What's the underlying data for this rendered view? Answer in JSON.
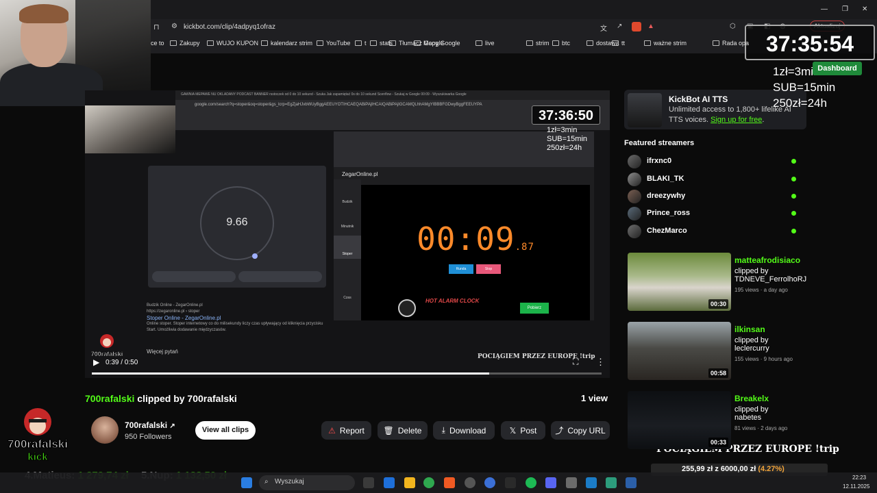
{
  "browser": {
    "url": "kickbot.com/clip/4adpyq1ofraz",
    "update_label": "Aktualizuj",
    "bookmarks": [
      "ce to",
      "Zakupy",
      "WUJO KUPON",
      "kalendarz strim",
      "YouTube",
      "t",
      "stats",
      "Tłumacz Google",
      "Mapy Google",
      "live",
      "strim",
      "btc",
      "dostawa",
      "tt",
      "ważne strim",
      "Rada opa"
    ]
  },
  "video": {
    "inner_tabs": "GAWNIA MEPAWE NU   OKLADANY PODCAST BANNER   rsstoczek od 0 do 10 sekund - Szuka   Jak zapamiętać 0s do 10 sekund   Scenflow - Szukaj w Google   00:09 - Wyszukiwarka Google",
    "inner_url": "google.com/search?q=stoper&oq=stoper&gs_lcrp=EgZjaHJvbWUyBggAEEUYOTIHCAEQABiPAjIHCAIQABiPAjIGCAMQLhhAMgYIBBBFGDwyBggFEEUYPA",
    "stopwatch_value": "9.66",
    "serp_source": "Budzik Online - ZegarOnline.pl",
    "serp_source_url": "https://zegaronline.pl › stoper",
    "serp_title": "Stoper Online - ZegarOnline.pl",
    "serp_snippet": "Online stoper. Stoper internetowy co do milisekundy liczy czas upływający od kliknięcia przycisku Start. Umożliwia dodawanie międzyczasów.",
    "serp_more": "Więcej pytań",
    "zegar_title": "ZegarOnline.pl",
    "zegar_clock_main": "00:09",
    "zegar_clock_ms": ".87",
    "zegar_btn_lap": "Runda",
    "zegar_btn_stop": "Stop",
    "zegar_ad": "HOT ALARM CLOCK",
    "zegar_ad_btn": "Pobierz",
    "zegar_side": [
      "Budzik",
      "Minutnik",
      "Stoper",
      "Czas"
    ],
    "overlay_timer": "37:36:50",
    "overlay_rates": [
      "1zł=3min",
      "SUB=15min",
      "250zł=24h"
    ],
    "overlay_bottom": "POCIĄGIEM PRZEZ EUROPE !trip",
    "logo_text": "700rafalski",
    "time": "0:39 / 0:50",
    "progress": 0.78
  },
  "clip": {
    "streamer": "700rafalski",
    "clipped_by_label": "clipped by",
    "clipper": "700rafalski",
    "views": "1 view",
    "channel_name": "700rafalski",
    "followers": "950 Followers",
    "view_all": "View all clips"
  },
  "actions": {
    "report": "Report",
    "delete": "Delete",
    "download": "Download",
    "post": "Post",
    "copy": "Copy URL"
  },
  "sidebar": {
    "tts_title": "KickBot AI TTS",
    "tts_desc": "Unlimited access to 1,800+ lifelike AI TTS voices.",
    "tts_link": "Sign up for free",
    "featured_title": "Featured streamers",
    "streamers": [
      "ifrxnc0",
      "BLAKI_TK",
      "dreezywhy",
      "Prince_ross",
      "ChezMarco"
    ],
    "clips": [
      {
        "user": "matteafrodisiaco",
        "by": "clipped by",
        "clipper": "TDNEVE_FerrolhoRJ",
        "meta": "195 views · a day ago",
        "duration": "00:30"
      },
      {
        "user": "ilkinsan",
        "by": "clipped by",
        "clipper": "leclercurry",
        "meta": "155 views · 9 hours ago",
        "duration": "00:58"
      },
      {
        "user": "Breakelx",
        "by": "clipped by",
        "clipper": "nabetes",
        "meta": "81 views · 2 days ago",
        "duration": "00:33"
      }
    ]
  },
  "overlay": {
    "timer": "37:35:54",
    "rates": [
      "1zł=3min",
      "SUB=15min",
      "250zł=24h"
    ],
    "dashboard": "Dashboard",
    "bottom_text": "POCIĄGIEM PRZEZ EUROPE !trip",
    "goal_current": "255,99 zł",
    "goal_sep": "z",
    "goal_target": "6000,00 zł",
    "goal_pct": "(4.27%)",
    "logo_line1": "700rafalski",
    "logo_line2": "kick",
    "ticker": [
      {
        "rank": "4.Matieus:",
        "amount": "1 279,74 zł"
      },
      {
        "rank": "5.Nup:",
        "amount": "1 132,50 zł"
      }
    ]
  },
  "taskbar": {
    "search": "Wyszukaj",
    "time": "22:23",
    "date": "12.11.2025"
  },
  "colors": {
    "kick_green": "#53fc18",
    "background": "#0b0b0b"
  }
}
